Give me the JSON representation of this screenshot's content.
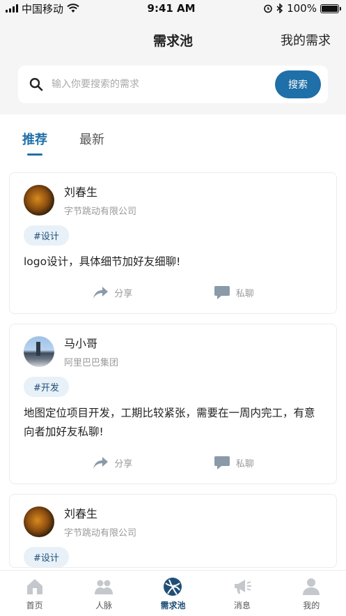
{
  "status_bar": {
    "carrier": "中国移动",
    "time": "9:41 AM",
    "battery": "100%"
  },
  "header": {
    "title": "需求池",
    "my_demand": "我的需求"
  },
  "search": {
    "placeholder": "输入你要搜索的需求",
    "button": "搜索"
  },
  "tabs": [
    {
      "label": "推荐",
      "active": true
    },
    {
      "label": "最新",
      "active": false
    }
  ],
  "posts": [
    {
      "name": "刘春生",
      "company": "字节跳动有限公司",
      "tag": "#设计",
      "content": "logo设计，具体细节加好友细聊!",
      "share": "分享",
      "chat": "私聊"
    },
    {
      "name": "马小哥",
      "company": "阿里巴巴集团",
      "tag": "#开发",
      "content": "地图定位项目开发，工期比较紧张，需要在一周内完工，有意向者加好友私聊!",
      "share": "分享",
      "chat": "私聊"
    },
    {
      "name": "刘春生",
      "company": "字节跳动有限公司",
      "tag": "#设计",
      "content": ""
    }
  ],
  "tab_bar": [
    {
      "label": "首页",
      "icon": "home-icon"
    },
    {
      "label": "人脉",
      "icon": "contacts-icon"
    },
    {
      "label": "需求池",
      "icon": "demand-pool-icon",
      "active": true
    },
    {
      "label": "消息",
      "icon": "megaphone-icon"
    },
    {
      "label": "我的",
      "icon": "profile-icon"
    }
  ],
  "colors": {
    "accent": "#1f6fa8",
    "tag_bg": "#e8f1f8",
    "muted": "#999999"
  }
}
